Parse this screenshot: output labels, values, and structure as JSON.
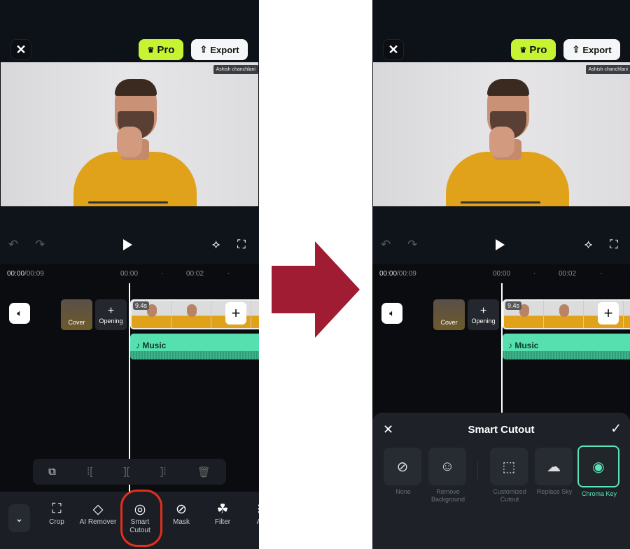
{
  "header": {
    "close_icon": "close-icon",
    "pro_label": "Pro",
    "export_label": "Export"
  },
  "preview": {
    "watermark": "Ashish chanchlani"
  },
  "timeline": {
    "current": "00:00",
    "total": "/00:09",
    "ticks": [
      "00:00",
      "·",
      "00:02",
      "·"
    ],
    "cover_label": "Cover",
    "opening_label": "Opening",
    "clip_duration": "9.4s",
    "music_label": "Music"
  },
  "toolbar": {
    "items": [
      {
        "label": "Crop",
        "icon": "crop-icon"
      },
      {
        "label": "AI Remover",
        "icon": "eraser-ai-icon"
      },
      {
        "label": "Smart Cutout",
        "icon": "smart-cutout-icon"
      },
      {
        "label": "Mask",
        "icon": "mask-icon"
      },
      {
        "label": "Filter",
        "icon": "filter-icon"
      },
      {
        "label": "A"
      }
    ]
  },
  "smart_cutout": {
    "title": "Smart Cutout",
    "options": [
      {
        "label": "None"
      },
      {
        "label": "Remove Background"
      },
      {
        "label": "Customized Cutout"
      },
      {
        "label": "Replace Sky"
      },
      {
        "label": "Chroma Key",
        "selected": true
      }
    ]
  },
  "colors": {
    "pro": "#c6f432",
    "music": "#56e0b0",
    "highlight": "#e0301e",
    "arrow": "#a01c33",
    "selected": "#5de3b5"
  }
}
